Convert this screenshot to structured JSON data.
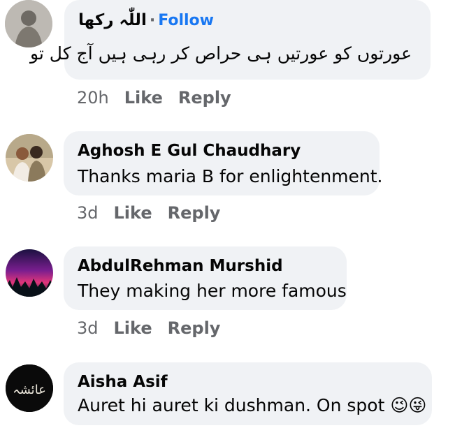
{
  "comments": [
    {
      "author": "اللّٰہ رکھا",
      "follow_label": "Follow",
      "separator": "·",
      "text": "عورتوں کو عورتیں ہی حراص کر رہی ہیں آج کل تو",
      "time": "20h",
      "like_label": "Like",
      "reply_label": "Reply"
    },
    {
      "author": "Aghosh E Gul Chaudhary",
      "text": "Thanks maria B for enlightenment.",
      "time": "3d",
      "like_label": "Like",
      "reply_label": "Reply"
    },
    {
      "author": "AbdulRehman Murshid",
      "text": "They making her more famous",
      "time": "3d",
      "like_label": "Like",
      "reply_label": "Reply"
    },
    {
      "author": "Aisha Asif",
      "text": "Auret hi auret ki dushman. On spot",
      "emoji": "😉😜"
    }
  ],
  "avatar_calligraphy": "عائشہ"
}
